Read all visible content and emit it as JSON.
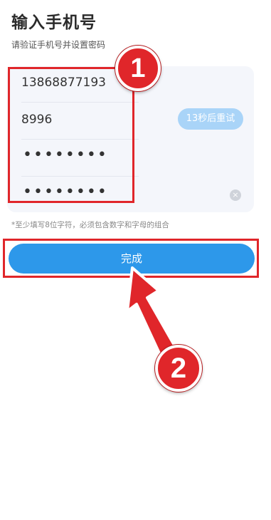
{
  "header": {
    "title": "输入手机号",
    "subtitle": "请验证手机号并设置密码"
  },
  "form": {
    "phone_value": "13868877193",
    "code_value": "8996",
    "retry_label": "13秒后重试",
    "password_mask": "••••••••",
    "confirm_password_mask": "••••••••",
    "clear_glyph": "×"
  },
  "hint": "*至少填写8位字符，必须包含数字和字母的组合",
  "done_label": "完成",
  "annotations": {
    "step1": "1",
    "step2": "2",
    "color": "#e0262a"
  },
  "colors": {
    "primary": "#2d98ea",
    "retry_bg": "#a9d4f8",
    "card_bg": "#f4f6fb"
  }
}
